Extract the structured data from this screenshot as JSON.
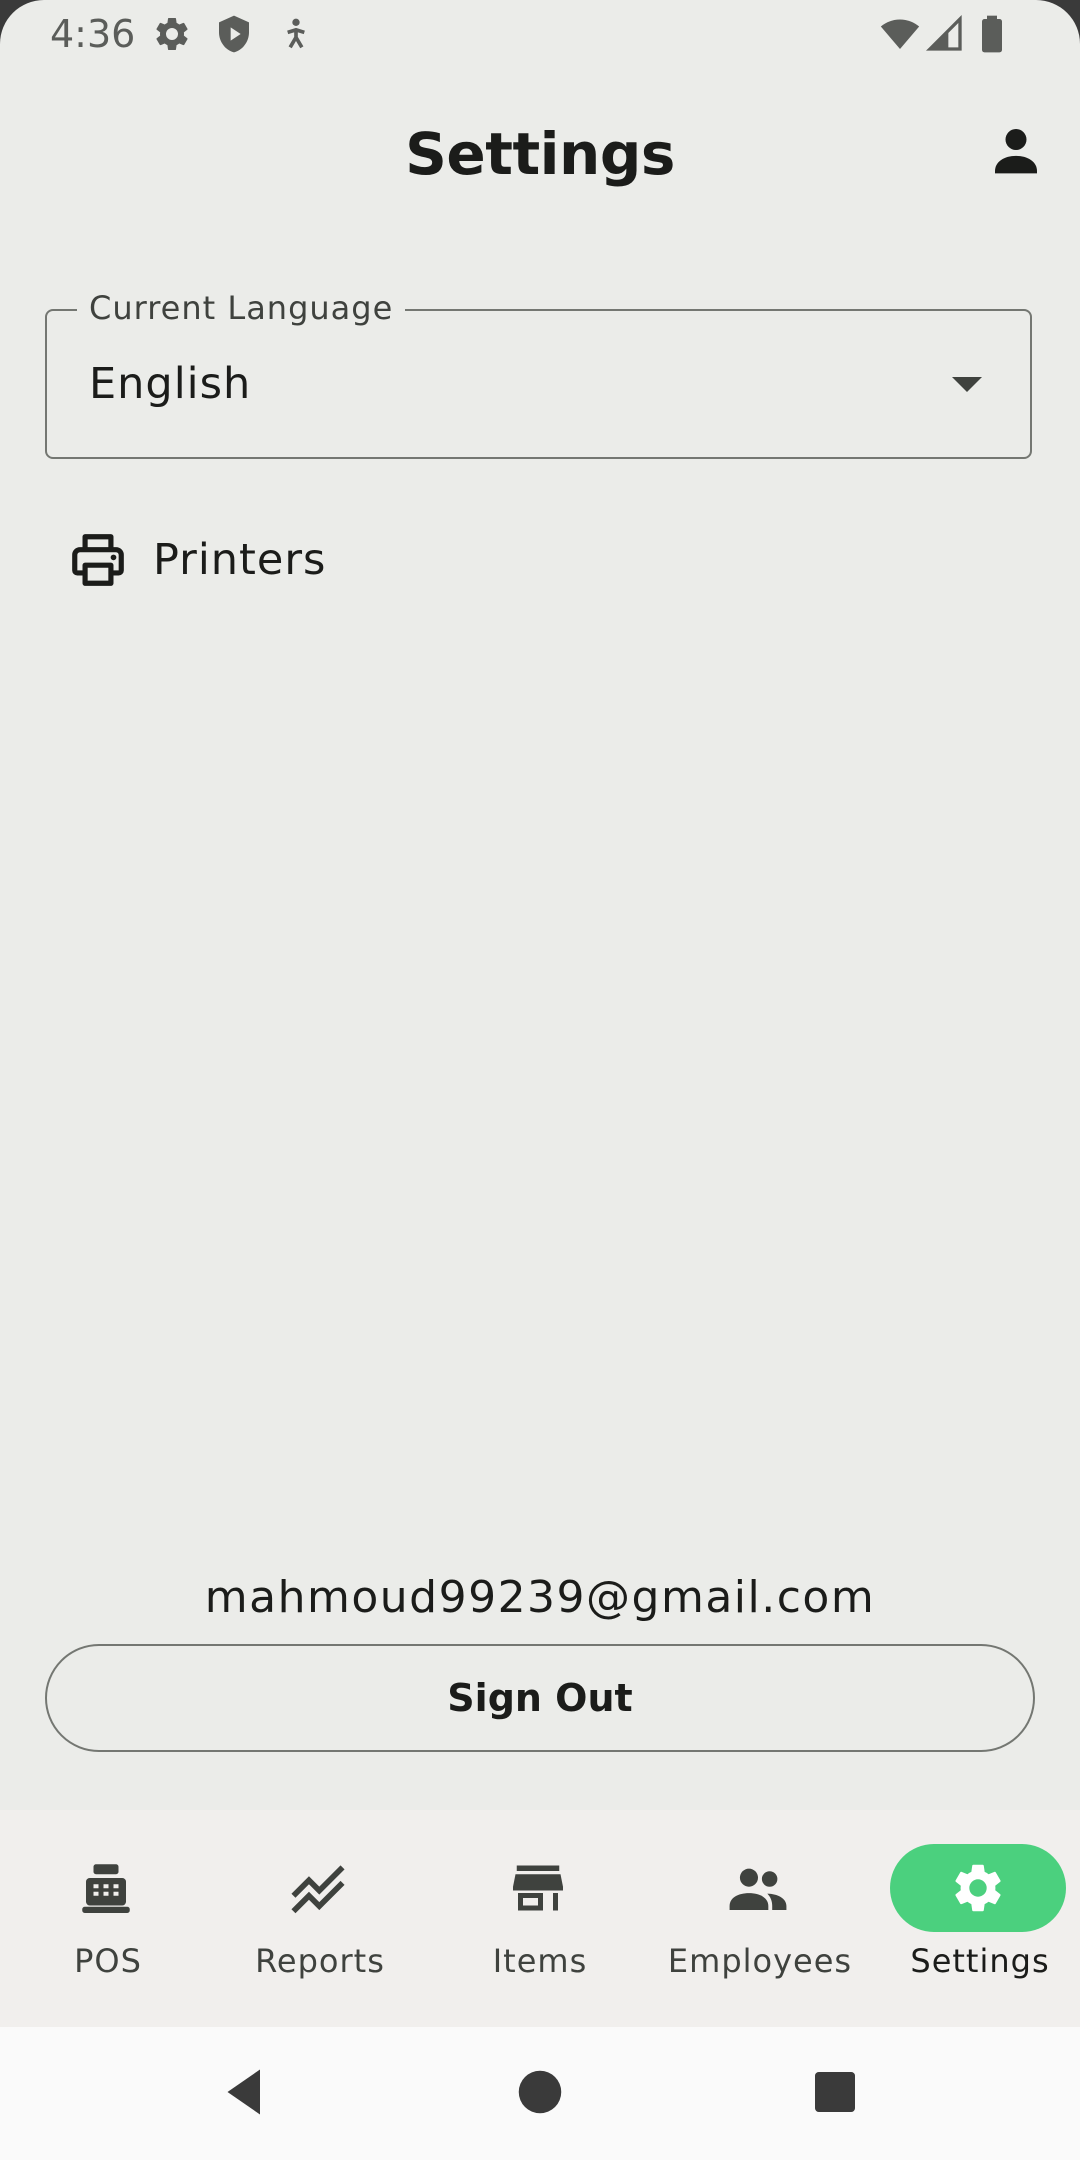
{
  "status_bar": {
    "time": "4:36",
    "icons": [
      "gear-icon",
      "shield-icon",
      "accessibility-icon",
      "wifi-icon",
      "cell-signal-icon",
      "battery-icon"
    ]
  },
  "header": {
    "title": "Settings",
    "account_icon": "person-icon"
  },
  "language": {
    "label": "Current Language",
    "value": "English",
    "icon": "dropdown-arrow-icon"
  },
  "printers": {
    "label": "Printers",
    "icon": "printer-icon"
  },
  "account": {
    "email": "mahmoud99239@gmail.com",
    "sign_out_label": "Sign Out"
  },
  "bottom_nav": {
    "items": [
      {
        "label": "POS",
        "icon": "cash-register-icon",
        "active": false
      },
      {
        "label": "Reports",
        "icon": "trend-chart-icon",
        "active": false
      },
      {
        "label": "Items",
        "icon": "store-icon",
        "active": false
      },
      {
        "label": "Employees",
        "icon": "people-icon",
        "active": false
      },
      {
        "label": "Settings",
        "icon": "gear-icon",
        "active": true
      }
    ]
  },
  "colors": {
    "background": "#ebece9",
    "nav_background": "#f1efed",
    "accent": "#4bd07e",
    "text": "#1b1c1a",
    "outline": "#747772"
  }
}
